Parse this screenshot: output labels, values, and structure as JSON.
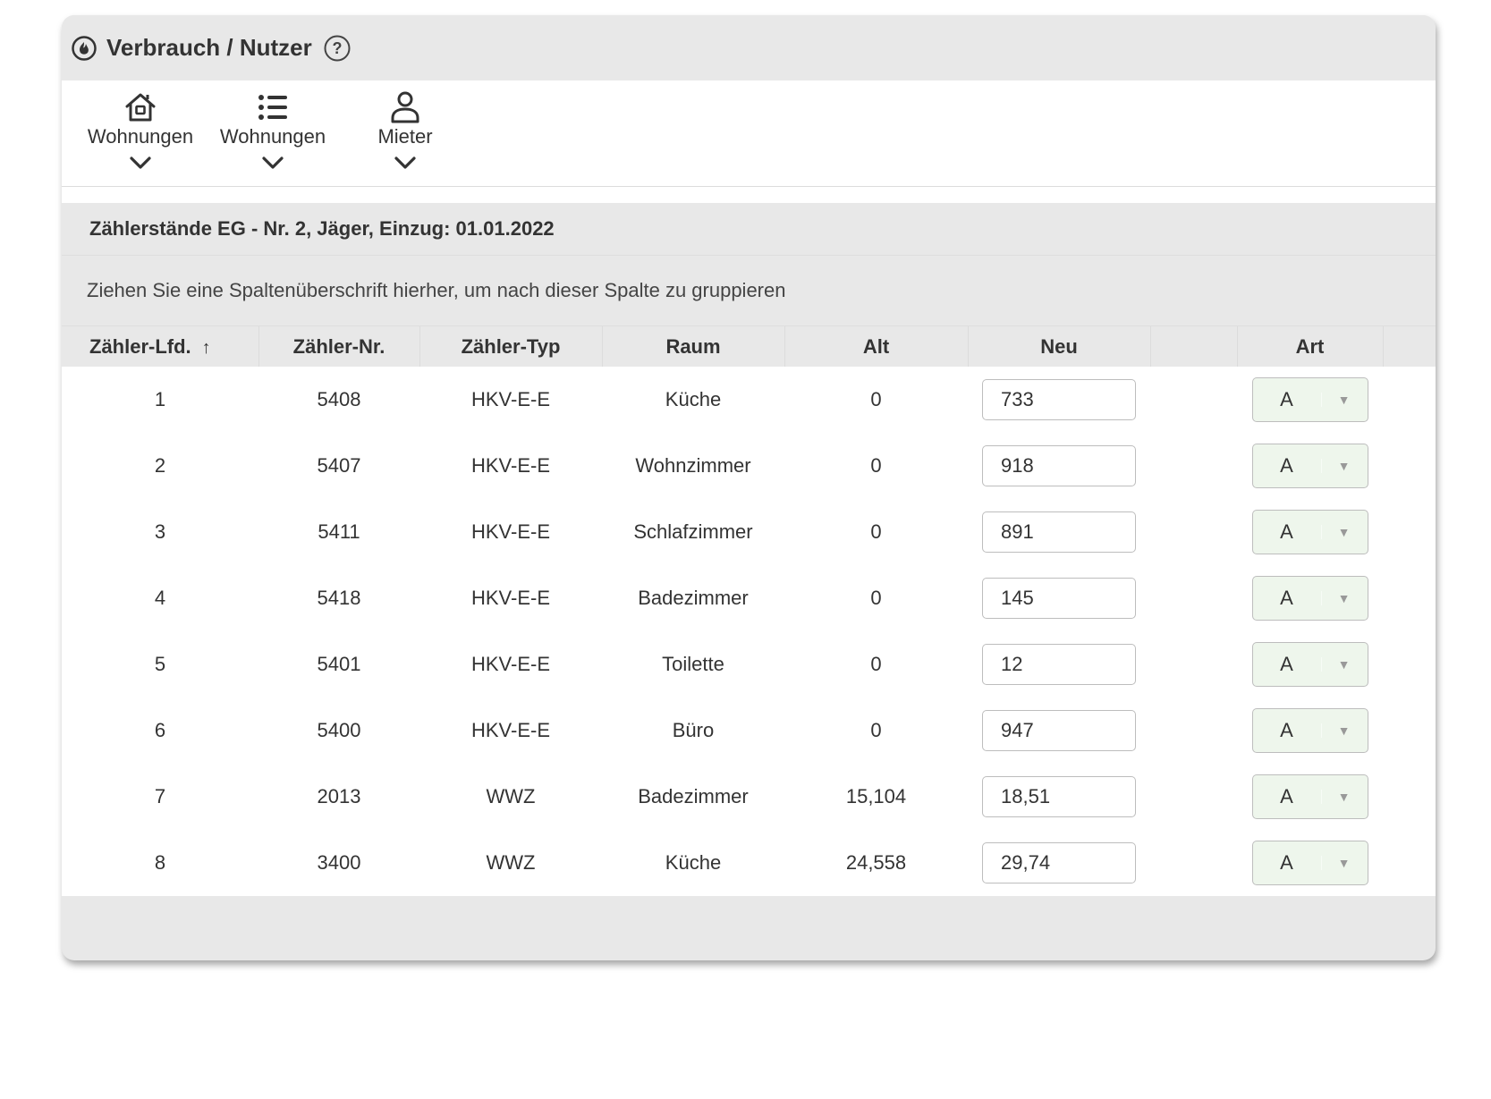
{
  "header": {
    "title": "Verbrauch / Nutzer",
    "icon": "flame-icon",
    "help_icon": "help-icon"
  },
  "toolbar": {
    "items": [
      {
        "label": "Wohnungen",
        "icon": "house-icon"
      },
      {
        "label": "Wohnungen",
        "icon": "list-icon"
      },
      {
        "label": "Mieter",
        "icon": "person-icon"
      }
    ]
  },
  "section": {
    "title": "Zählerstände EG - Nr. 2, Jäger, Einzug: 01.01.2022",
    "group_hint": "Ziehen Sie eine Spaltenüberschrift hierher, um nach dieser Spalte zu gruppieren"
  },
  "grid": {
    "columns": {
      "lfd": "Zähler-Lfd.",
      "lfd_sort": "↑",
      "nr": "Zähler-Nr.",
      "typ": "Zähler-Typ",
      "raum": "Raum",
      "alt": "Alt",
      "neu": "Neu",
      "blank": "",
      "art": "Art"
    },
    "rows": [
      {
        "lfd": "1",
        "nr": "5408",
        "typ": "HKV-E-E",
        "raum": "Küche",
        "alt": "0",
        "neu": "733",
        "art": "A"
      },
      {
        "lfd": "2",
        "nr": "5407",
        "typ": "HKV-E-E",
        "raum": "Wohnzimmer",
        "alt": "0",
        "neu": "918",
        "art": "A"
      },
      {
        "lfd": "3",
        "nr": "5411",
        "typ": "HKV-E-E",
        "raum": "Schlafzimmer",
        "alt": "0",
        "neu": "891",
        "art": "A"
      },
      {
        "lfd": "4",
        "nr": "5418",
        "typ": "HKV-E-E",
        "raum": "Badezimmer",
        "alt": "0",
        "neu": "145",
        "art": "A"
      },
      {
        "lfd": "5",
        "nr": "5401",
        "typ": "HKV-E-E",
        "raum": "Toilette",
        "alt": "0",
        "neu": "12",
        "art": "A"
      },
      {
        "lfd": "6",
        "nr": "5400",
        "typ": "HKV-E-E",
        "raum": "Büro",
        "alt": "0",
        "neu": "947",
        "art": "A"
      },
      {
        "lfd": "7",
        "nr": "2013",
        "typ": "WWZ",
        "raum": "Badezimmer",
        "alt": "15,104",
        "neu": "18,51",
        "art": "A"
      },
      {
        "lfd": "8",
        "nr": "3400",
        "typ": "WWZ",
        "raum": "Küche",
        "alt": "24,558",
        "neu": "29,74",
        "art": "A"
      }
    ]
  },
  "colors": {
    "panel_bg": "#e8e8e8",
    "select_bg": "#eef6ec"
  }
}
